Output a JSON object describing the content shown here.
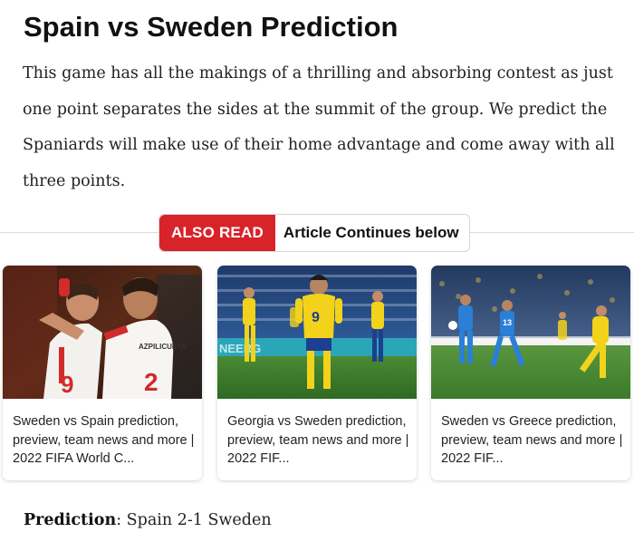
{
  "article": {
    "title": "Spain vs Sweden Prediction",
    "intro": "This game has all the makings of a thrilling and absorbing contest as just one point separates the sides at the summit of the group. We predict the Spaniards will make use of their home advantage and come away with all three points."
  },
  "also_read": {
    "badge": "ALSO READ",
    "continues": "Article Continues below"
  },
  "related": [
    {
      "caption": "Sweden vs Spain prediction, preview, team news and more | 2022 FIFA World C...",
      "image_icon": "football-celebration-photo"
    },
    {
      "caption": "Georgia vs Sweden prediction, preview, team news and more | 2022 FIF...",
      "image_icon": "football-player-photo"
    },
    {
      "caption": "Sweden vs Greece prediction, preview, team news and more | 2022 FIF...",
      "image_icon": "football-match-action-photo"
    }
  ],
  "prediction": {
    "label": "Prediction",
    "value": ": Spain 2-1 Sweden"
  },
  "colors": {
    "badge_red": "#d8232a",
    "sweden_yellow": "#f2d21b",
    "pitch_green": "#3c7a2c"
  }
}
